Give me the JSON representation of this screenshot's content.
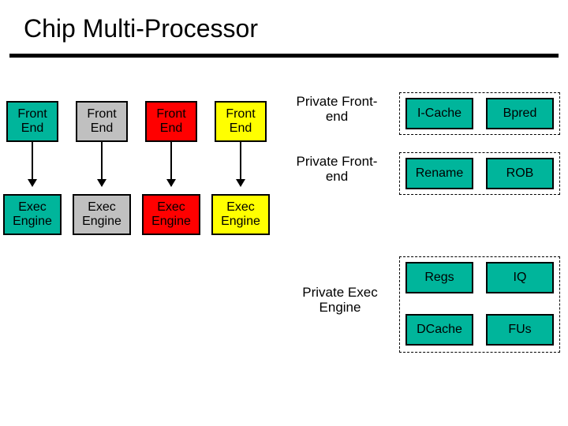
{
  "title": "Chip Multi-Processor",
  "front_end": "Front End",
  "exec_engine": "Exec Engine",
  "private_front_end": "Private Front-end",
  "private_exec_engine": "Private Exec Engine",
  "icache": "I-Cache",
  "bpred": "Bpred",
  "rename": "Rename",
  "rob": "ROB",
  "regs": "Regs",
  "iq": "IQ",
  "dcache": "DCache",
  "fus": "FUs"
}
